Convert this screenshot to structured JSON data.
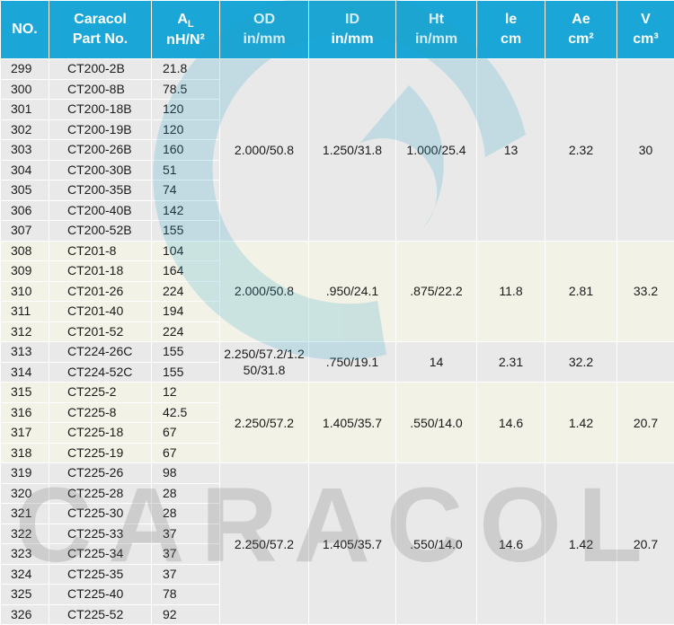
{
  "headers": {
    "no": "NO.",
    "part_line1": "Caracol",
    "part_line2": "Part No.",
    "al_main": "A",
    "al_sub": "L",
    "al_unit": "nH/N²",
    "od_line1": "OD",
    "od_line2": "in/mm",
    "id_line1": "ID",
    "id_line2": "in/mm",
    "ht_line1": "Ht",
    "ht_line2": "in/mm",
    "le_line1": "le",
    "le_line2": "cm",
    "ae_line1": "Ae",
    "ae_line2": "cm²",
    "v_line1": "V",
    "v_line2": "cm³"
  },
  "watermark": {
    "text": "CARACOL"
  },
  "groups": [
    {
      "od": "2.000/50.8",
      "id": "1.250/31.8",
      "ht": "1.000/25.4",
      "le": "13",
      "ae": "2.32",
      "v": "30",
      "rows": [
        {
          "no": "299",
          "part": "CT200-2B",
          "al": "21.8"
        },
        {
          "no": "300",
          "part": "CT200-8B",
          "al": "78.5"
        },
        {
          "no": "301",
          "part": "CT200-18B",
          "al": "120"
        },
        {
          "no": "302",
          "part": "CT200-19B",
          "al": "120"
        },
        {
          "no": "303",
          "part": "CT200-26B",
          "al": "160"
        },
        {
          "no": "304",
          "part": "CT200-30B",
          "al": "51"
        },
        {
          "no": "305",
          "part": "CT200-35B",
          "al": "74"
        },
        {
          "no": "306",
          "part": "CT200-40B",
          "al": "142"
        },
        {
          "no": "307",
          "part": "CT200-52B",
          "al": "155"
        }
      ]
    },
    {
      "od": "2.000/50.8",
      "id": ".950/24.1",
      "ht": ".875/22.2",
      "le": "11.8",
      "ae": "2.81",
      "v": "33.2",
      "rows": [
        {
          "no": "308",
          "part": "CT201-8",
          "al": "104"
        },
        {
          "no": "309",
          "part": "CT201-18",
          "al": "164"
        },
        {
          "no": "310",
          "part": "CT201-26",
          "al": "224"
        },
        {
          "no": "311",
          "part": "CT201-40",
          "al": "194"
        },
        {
          "no": "312",
          "part": "CT201-52",
          "al": "224"
        }
      ]
    },
    {
      "od": "2.250/57.2/1.2 50/31.8",
      "id": ".750/19.1",
      "ht": "14",
      "le": "2.31",
      "ae": "32.2",
      "v": "",
      "rows": [
        {
          "no": "313",
          "part": "CT224-26C",
          "al": "155"
        },
        {
          "no": "314",
          "part": "CT224-52C",
          "al": "155"
        }
      ]
    },
    {
      "od": "2.250/57.2",
      "id": "1.405/35.7",
      "ht": ".550/14.0",
      "le": "14.6",
      "ae": "1.42",
      "v": "20.7",
      "rows": [
        {
          "no": "315",
          "part": "CT225-2",
          "al": "12"
        },
        {
          "no": "316",
          "part": "CT225-8",
          "al": "42.5"
        },
        {
          "no": "317",
          "part": "CT225-18",
          "al": "67"
        },
        {
          "no": "318",
          "part": "CT225-19",
          "al": "67"
        }
      ]
    },
    {
      "od": "2.250/57.2",
      "id": "1.405/35.7",
      "ht": ".550/14.0",
      "le": "14.6",
      "ae": "1.42",
      "v": "20.7",
      "rows": [
        {
          "no": "319",
          "part": "CT225-26",
          "al": "98"
        },
        {
          "no": "320",
          "part": "CT225-28",
          "al": "28"
        },
        {
          "no": "321",
          "part": "CT225-30",
          "al": "28"
        },
        {
          "no": "322",
          "part": "CT225-33",
          "al": "37"
        },
        {
          "no": "323",
          "part": "CT225-34",
          "al": "37"
        },
        {
          "no": "324",
          "part": "CT225-35",
          "al": "37"
        },
        {
          "no": "325",
          "part": "CT225-40",
          "al": "78"
        },
        {
          "no": "326",
          "part": "CT225-52",
          "al": "92"
        }
      ]
    }
  ]
}
